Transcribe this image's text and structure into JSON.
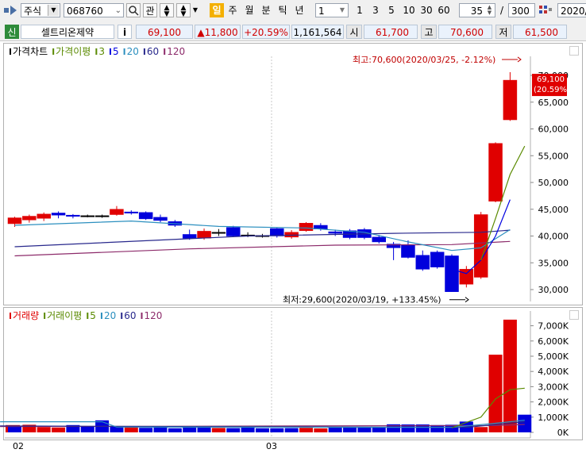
{
  "toolbar": {
    "market": "주식",
    "code": "068760",
    "btn_gwan": "관",
    "periods": [
      "일",
      "주",
      "월",
      "분",
      "틱",
      "년"
    ],
    "active_period": "일",
    "interval_value": "1",
    "interval_buttons": [
      "1",
      "3",
      "5",
      "10",
      "30",
      "60"
    ],
    "count_value": "35",
    "slash": "/",
    "total_value": "300",
    "date_value": "2020/"
  },
  "quote": {
    "badge": "신",
    "name": "셀트리온제약",
    "info": "i",
    "price": "69,100",
    "change": "▲11,800",
    "rate": "+20.59%",
    "volume": "1,161,564",
    "open_label": "시",
    "open": "61,700",
    "high_label": "고",
    "high": "70,600",
    "low_label": "저",
    "low": "61,500"
  },
  "colors": {
    "up": "#e00000",
    "down": "#0000dc",
    "ma3": "#5a8a00",
    "ma5": "#0000e0",
    "ma20": "#2b8fbf",
    "ma60": "#28288c",
    "ma120": "#8c2a6a"
  },
  "chart_data": [
    {
      "type": "candlestick",
      "legend": [
        "가격차트",
        "가격이평",
        "3",
        "5",
        "20",
        "60",
        "120"
      ],
      "x_ticks": [
        "02",
        "03"
      ],
      "y_ticks": [
        "30,000",
        "35,000",
        "40,000",
        "45,000",
        "50,000",
        "55,000",
        "60,000",
        "65,000",
        "70,000"
      ],
      "ylim": [
        28000,
        72000
      ],
      "last_label": "69,100",
      "last_rate": "(20.59%)",
      "high_annotation": "최고:70,600(2020/03/25, -2.12%)",
      "low_annotation": "최저:29,600(2020/03/19, +133.45%)",
      "candles": [
        {
          "o": 42300,
          "c": 43400,
          "h": 43600,
          "l": 41700
        },
        {
          "o": 43000,
          "c": 43700,
          "h": 44000,
          "l": 42500
        },
        {
          "o": 43300,
          "c": 44100,
          "h": 44400,
          "l": 42800
        },
        {
          "o": 44300,
          "c": 43900,
          "h": 44600,
          "l": 43300
        },
        {
          "o": 43900,
          "c": 43700,
          "h": 44100,
          "l": 43300
        },
        {
          "o": 43800,
          "c": 43800,
          "h": 44000,
          "l": 43500
        },
        {
          "o": 43800,
          "c": 43800,
          "h": 44000,
          "l": 43400
        },
        {
          "o": 44000,
          "c": 45000,
          "h": 45600,
          "l": 43800
        },
        {
          "o": 44500,
          "c": 44400,
          "h": 44800,
          "l": 44000
        },
        {
          "o": 44400,
          "c": 43200,
          "h": 44600,
          "l": 43000
        },
        {
          "o": 43500,
          "c": 42900,
          "h": 44000,
          "l": 42600
        },
        {
          "o": 42700,
          "c": 42000,
          "h": 43000,
          "l": 41700
        },
        {
          "o": 40300,
          "c": 39600,
          "h": 41200,
          "l": 39300
        },
        {
          "o": 39600,
          "c": 40900,
          "h": 41400,
          "l": 39300
        },
        {
          "o": 40700,
          "c": 40700,
          "h": 41300,
          "l": 40000
        },
        {
          "o": 41600,
          "c": 40000,
          "h": 41900,
          "l": 39800
        },
        {
          "o": 40200,
          "c": 40200,
          "h": 40700,
          "l": 39800
        },
        {
          "o": 40100,
          "c": 40100,
          "h": 40400,
          "l": 39700
        },
        {
          "o": 41400,
          "c": 40000,
          "h": 41500,
          "l": 39700
        },
        {
          "o": 39800,
          "c": 40700,
          "h": 41100,
          "l": 39500
        },
        {
          "o": 41000,
          "c": 42400,
          "h": 42600,
          "l": 40800
        },
        {
          "o": 42000,
          "c": 41300,
          "h": 42400,
          "l": 41000
        },
        {
          "o": 40800,
          "c": 40500,
          "h": 41200,
          "l": 40000
        },
        {
          "o": 41000,
          "c": 39700,
          "h": 41300,
          "l": 39400
        },
        {
          "o": 41200,
          "c": 39700,
          "h": 41500,
          "l": 39400
        },
        {
          "o": 39800,
          "c": 38900,
          "h": 40200,
          "l": 38600
        },
        {
          "o": 38500,
          "c": 37800,
          "h": 38900,
          "l": 35500
        },
        {
          "o": 38300,
          "c": 36000,
          "h": 39200,
          "l": 35800
        },
        {
          "o": 36400,
          "c": 33800,
          "h": 37300,
          "l": 33500
        },
        {
          "o": 37000,
          "c": 34200,
          "h": 37300,
          "l": 33900
        },
        {
          "o": 36300,
          "c": 29600,
          "h": 36600,
          "l": 29600
        },
        {
          "o": 31000,
          "c": 33800,
          "h": 34400,
          "l": 30400
        },
        {
          "o": 32300,
          "c": 44000,
          "h": 44500,
          "l": 32000
        },
        {
          "o": 46500,
          "c": 57300,
          "h": 57500,
          "l": 46300
        },
        {
          "o": 61700,
          "c": 69100,
          "h": 70600,
          "l": 61500
        }
      ],
      "ma3": [
        [
          32,
          35500
        ],
        [
          33,
          43300
        ],
        [
          34,
          51500
        ],
        [
          35,
          56800
        ]
      ],
      "ma5": [
        [
          30,
          33800
        ],
        [
          31,
          33000
        ],
        [
          32,
          35500
        ],
        [
          33,
          40000
        ],
        [
          34,
          46800
        ]
      ],
      "ma20": [
        [
          0,
          42000
        ],
        [
          8,
          42800
        ],
        [
          14,
          41800
        ],
        [
          20,
          41500
        ],
        [
          24,
          40700
        ],
        [
          27,
          38900
        ],
        [
          30,
          37300
        ],
        [
          32,
          37800
        ],
        [
          34,
          41200
        ]
      ],
      "ma60": [
        [
          0,
          38000
        ],
        [
          16,
          40000
        ],
        [
          26,
          40500
        ],
        [
          32,
          40700
        ],
        [
          34,
          41100
        ]
      ],
      "ma120": [
        [
          0,
          36300
        ],
        [
          12,
          37600
        ],
        [
          22,
          38300
        ],
        [
          30,
          38400
        ],
        [
          34,
          39000
        ]
      ]
    },
    {
      "type": "bar",
      "legend": [
        "거래량",
        "거래이평",
        "5",
        "20",
        "60",
        "120"
      ],
      "y_ticks": [
        "0K",
        "1,000K",
        "2,000K",
        "3,000K",
        "4,000K",
        "5,000K",
        "6,000K",
        "7,000K"
      ],
      "ylim": [
        0,
        7800000
      ],
      "values": [
        480000,
        380000,
        500000,
        350000,
        320000,
        480000,
        400000,
        790000,
        380000,
        350000,
        300000,
        380000,
        270000,
        330000,
        330000,
        290000,
        280000,
        380000,
        270000,
        270000,
        280000,
        300000,
        260000,
        330000,
        320000,
        320000,
        330000,
        530000,
        520000,
        520000,
        480000,
        500000,
        710000,
        350000,
        5100000,
        7400000,
        1161564
      ],
      "ma5": [
        [
          31,
          300000
        ],
        [
          33,
          1000000
        ],
        [
          34,
          2200000
        ],
        [
          35,
          2800000
        ],
        [
          36,
          2900000
        ]
      ],
      "ma20": [
        [
          0,
          700000
        ],
        [
          7,
          700000
        ],
        [
          8,
          350000
        ],
        [
          31,
          330000
        ],
        [
          34,
          600000
        ],
        [
          36,
          800000
        ]
      ],
      "ma60": [
        [
          0,
          420000
        ],
        [
          32,
          330000
        ],
        [
          36,
          700000
        ]
      ],
      "ma120": [
        [
          0,
          380000
        ],
        [
          34,
          450000
        ],
        [
          36,
          520000
        ]
      ]
    }
  ]
}
